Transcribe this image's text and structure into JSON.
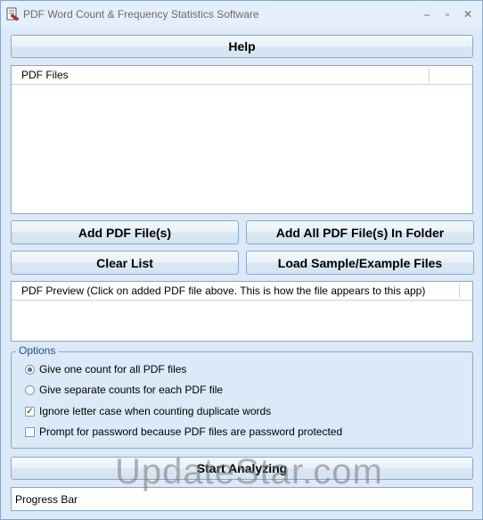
{
  "window": {
    "title": "PDF Word Count & Frequency Statistics Software"
  },
  "titlebar": {
    "icon": "app-icon",
    "minimize_glyph": "–",
    "maximize_glyph": "▫",
    "close_glyph": "✕"
  },
  "buttons": {
    "help": "Help",
    "add_files": "Add PDF File(s)",
    "add_folder": "Add All PDF File(s) In Folder",
    "clear_list": "Clear List",
    "load_sample": "Load Sample/Example Files",
    "start": "Start Analyzing"
  },
  "files_list": {
    "header": "PDF Files",
    "items": []
  },
  "preview": {
    "header": "PDF Preview (Click on added PDF file above. This is how the file appears to this app)"
  },
  "options": {
    "label": "Options",
    "items": [
      {
        "label": "Give one count for all PDF files",
        "type": "radio",
        "checked": true
      },
      {
        "label": "Give separate counts for each PDF file",
        "type": "radio",
        "checked": false
      },
      {
        "label": "Ignore letter case when counting duplicate words",
        "type": "checkbox",
        "checked": true
      },
      {
        "label": "Prompt for password because PDF files are password protected",
        "type": "checkbox",
        "checked": false
      }
    ]
  },
  "progress": {
    "label": "Progress Bar"
  },
  "watermark": "UpdateStar.com",
  "colors": {
    "window_bg": "#dbe9f8",
    "group_label": "#1f4c8a",
    "border": "#8ea8c4"
  }
}
